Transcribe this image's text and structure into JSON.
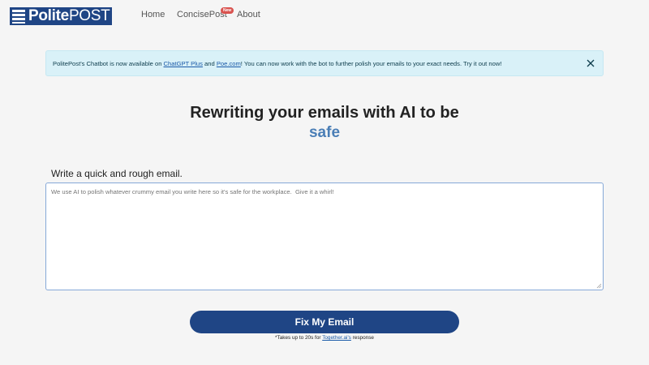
{
  "brand": {
    "name_bold": "Polite",
    "name_regular": "POST",
    "color": "#1f4585"
  },
  "nav": {
    "items": [
      {
        "label": "Home"
      },
      {
        "label": "ConcisePost",
        "badge": "New"
      },
      {
        "label": "About"
      }
    ]
  },
  "alert": {
    "prefix": "PolitePost's Chatbot is now available on ",
    "link1": "ChatGPT Plus",
    "middle": " and ",
    "link2": "Poe.com",
    "suffix": "! You can now work with the bot to further polish your emails to your exact needs. Try it out now!",
    "close_icon": "close-icon",
    "background": "#d9f1f8"
  },
  "hero": {
    "title": "Rewriting your emails with AI to be",
    "rotating_word": "safe",
    "accent": "#4a7eb6"
  },
  "form": {
    "label": "Write a quick and rough email.",
    "placeholder": "We use AI to polish whatever crummy email you write here so it's safe for the workplace.  Give it a whirl!",
    "value": "",
    "submit_label": "Fix My Email"
  },
  "footnote": {
    "prefix": "*Takes up to 20s for ",
    "link": "Together.ai's",
    "suffix": " response"
  }
}
